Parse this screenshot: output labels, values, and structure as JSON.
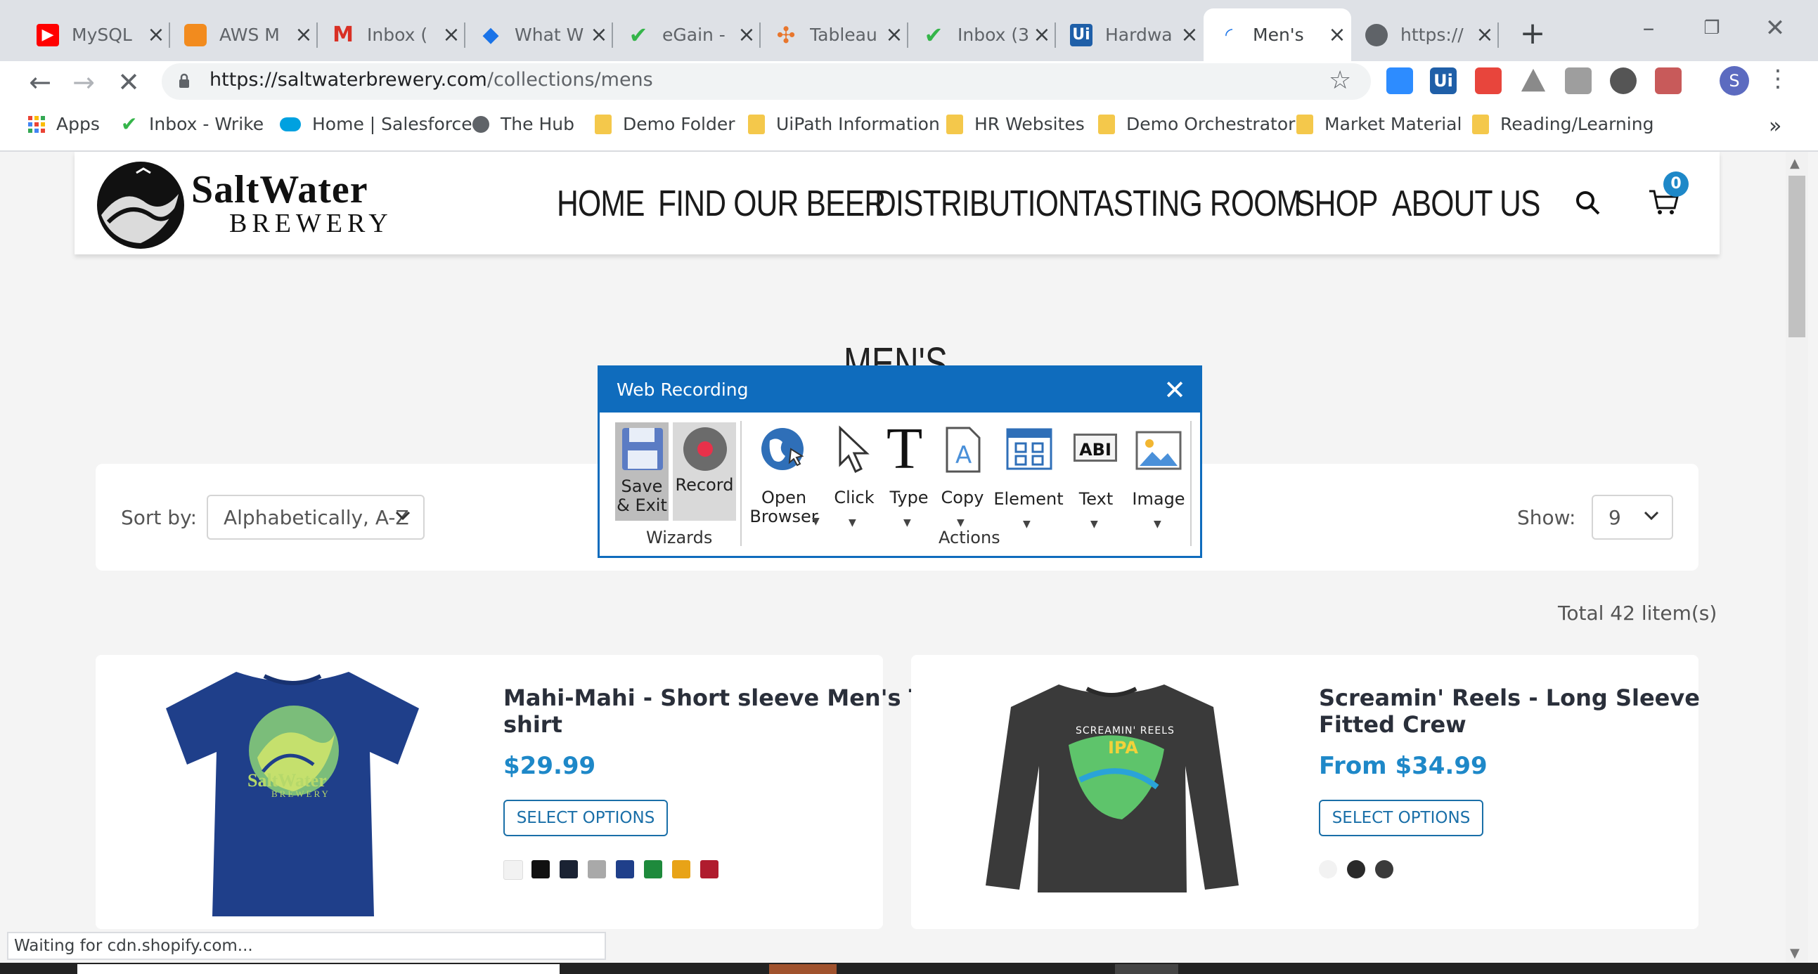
{
  "browser": {
    "tabs": [
      {
        "title": "MySQL",
        "icon": "youtube-icon",
        "color": "#ff0000"
      },
      {
        "title": "AWS M",
        "icon": "aws-icon",
        "color": "#f90"
      },
      {
        "title": "Inbox (",
        "icon": "gmail-icon",
        "color": "#d93025"
      },
      {
        "title": "What W",
        "icon": "diamond-icon",
        "color": "#1a73e8"
      },
      {
        "title": "eGain -",
        "icon": "check-icon",
        "color": "#35b54a"
      },
      {
        "title": "Tableau",
        "icon": "tableau-icon",
        "color": "#e8762d"
      },
      {
        "title": "Inbox (3",
        "icon": "check-icon",
        "color": "#35b54a"
      },
      {
        "title": "Hardwa",
        "icon": "uipath-icon",
        "color": "#1f5fa8"
      },
      {
        "title": "Men's",
        "icon": "loading-icon",
        "color": "#1a73e8"
      },
      {
        "title": "https://",
        "icon": "globe-icon",
        "color": "#5f6368"
      }
    ],
    "url_domain": "https://saltwaterbrewery.com",
    "url_path": "/collections/mens",
    "profile_initial": "S",
    "status_text": "Waiting for cdn.shopify.com...",
    "bookmarks": [
      {
        "label": "Apps",
        "icon": "apps-grid-icon"
      },
      {
        "label": "Inbox - Wrike",
        "icon": "check-icon"
      },
      {
        "label": "Home | Salesforce",
        "icon": "cloud-icon"
      },
      {
        "label": "The Hub",
        "icon": "globe-icon"
      },
      {
        "label": "Demo Folder",
        "icon": "folder-icon"
      },
      {
        "label": "UiPath Information",
        "icon": "folder-icon"
      },
      {
        "label": "HR Websites",
        "icon": "folder-icon"
      },
      {
        "label": "Demo Orchestrator",
        "icon": "folder-icon"
      },
      {
        "label": "Market Material",
        "icon": "folder-icon"
      },
      {
        "label": "Reading/Learning",
        "icon": "folder-icon"
      }
    ],
    "more_bookmarks": "»"
  },
  "site": {
    "logo_line1": "SaltWater",
    "logo_line2": "BREWERY",
    "nav": [
      "HOME",
      "FIND OUR BEER",
      "DISTRIBUTION",
      "TASTING ROOM",
      "SHOP",
      "ABOUT US"
    ],
    "cart_count": "0",
    "heading": "MEN'S",
    "sort_label": "Sort by:",
    "sort_value": "Alphabetically, A-Z",
    "show_label": "Show:",
    "show_value": "9",
    "total": "Total 42 litem(s)",
    "products": [
      {
        "title_line1": "Mahi-Mahi - Short sleeve Men's T-",
        "title_line2": "shirt",
        "price": "$29.99",
        "button": "SELECT OPTIONS",
        "swatches": [
          "#f2f2f2",
          "#111111",
          "#1a2233",
          "#a9a9a9",
          "#1f3f8a",
          "#1e8a3c",
          "#e8a317",
          "#b01c2e"
        ]
      },
      {
        "title_line1": "Screamin' Reels - Long Sleeve",
        "title_line2": "Fitted Crew",
        "price": "From $34.99",
        "button": "SELECT OPTIONS",
        "swatches": [
          "#f2f2f2",
          "#2a2a2a",
          "#3a3a3a"
        ],
        "shirt_text": "SCREAMIN' REELS",
        "shirt_text2": "IPA"
      }
    ]
  },
  "recorder": {
    "title": "Web Recording",
    "buttons": [
      {
        "label1": "Save",
        "label2": "& Exit"
      },
      {
        "label1": "Record",
        "label2": ""
      },
      {
        "label1": "Open",
        "label2": "Browser"
      },
      {
        "label1": "Click",
        "label2": ""
      },
      {
        "label1": "Type",
        "label2": ""
      },
      {
        "label1": "Copy",
        "label2": ""
      },
      {
        "label1": "Element",
        "label2": ""
      },
      {
        "label1": "Text",
        "label2": ""
      },
      {
        "label1": "Image",
        "label2": ""
      }
    ],
    "group_wizards": "Wizards",
    "group_actions": "Actions",
    "text_icon_label": "ABI"
  }
}
